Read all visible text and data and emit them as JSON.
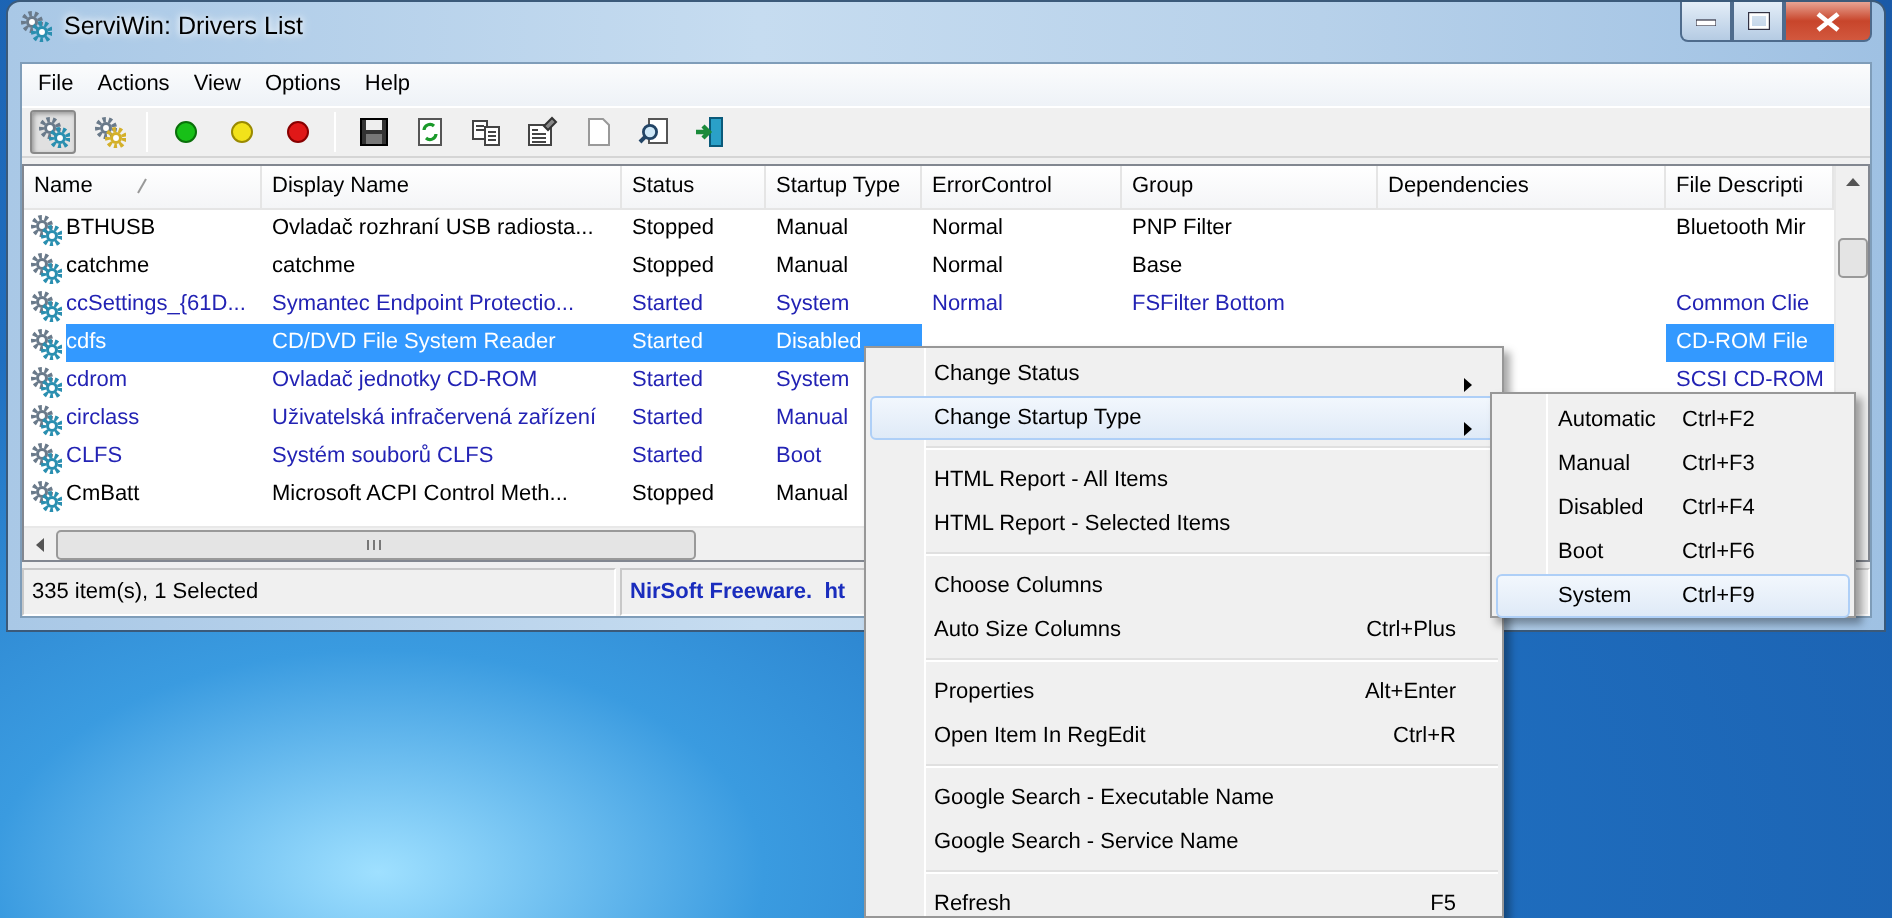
{
  "window": {
    "title": "ServiWin: Drivers List"
  },
  "menu_bar": [
    "File",
    "Actions",
    "View",
    "Options",
    "Help"
  ],
  "toolbar": [
    {
      "kind": "drivers",
      "pressed": true
    },
    {
      "kind": "services",
      "pressed": false
    },
    {
      "kind": "separator"
    },
    {
      "kind": "start",
      "pressed": false
    },
    {
      "kind": "pause",
      "pressed": false
    },
    {
      "kind": "stop",
      "pressed": false
    },
    {
      "kind": "separator"
    },
    {
      "kind": "save",
      "pressed": false
    },
    {
      "kind": "refresh",
      "pressed": false
    },
    {
      "kind": "copy",
      "pressed": false
    },
    {
      "kind": "properties",
      "pressed": false
    },
    {
      "kind": "report",
      "pressed": false
    },
    {
      "kind": "find",
      "pressed": false
    },
    {
      "kind": "exit",
      "pressed": false
    }
  ],
  "table": {
    "columns": [
      {
        "label": "Name",
        "sorted": true
      },
      {
        "label": "Display Name",
        "sorted": false
      },
      {
        "label": "Status",
        "sorted": false
      },
      {
        "label": "Startup Type",
        "sorted": false
      },
      {
        "label": "ErrorControl",
        "sorted": false
      },
      {
        "label": "Group",
        "sorted": false
      },
      {
        "label": "Dependencies",
        "sorted": false
      },
      {
        "label": "File Descripti",
        "sorted": false
      }
    ],
    "rows": [
      {
        "name": "BTHUSB",
        "display_name": "Ovladač rozhraní USB radiosta...",
        "status": "Stopped",
        "startup_type": "Manual",
        "error_control": "Normal",
        "group": "PNP Filter",
        "file_description": "Bluetooth Mir",
        "running": false,
        "selected": false
      },
      {
        "name": "catchme",
        "display_name": "catchme",
        "status": "Stopped",
        "startup_type": "Manual",
        "error_control": "Normal",
        "group": "Base",
        "running": false,
        "selected": false
      },
      {
        "name": "ccSettings_{61D...",
        "display_name": "Symantec Endpoint Protectio...",
        "status": "Started",
        "startup_type": "System",
        "error_control": "Normal",
        "group": "FSFilter Bottom",
        "file_description": "Common Clie",
        "running": true,
        "selected": false
      },
      {
        "name": "cdfs",
        "display_name": "CD/DVD File System Reader",
        "status": "Started",
        "startup_type": "Disabled",
        "file_description": "CD-ROM File",
        "selected": true
      },
      {
        "name": "cdrom",
        "display_name": "Ovladač jednotky CD-ROM",
        "status": "Started",
        "startup_type": "System",
        "file_description": "SCSI CD-ROM",
        "running": true,
        "selected": false
      },
      {
        "name": "circlass",
        "display_name": "Uživatelská infračervená zařízení",
        "status": "Started",
        "startup_type": "Manual",
        "running": true,
        "selected": false
      },
      {
        "name": "CLFS",
        "display_name": "Systém souborů CLFS",
        "status": "Started",
        "startup_type": "Boot",
        "running": true,
        "selected": false
      },
      {
        "name": "CmBatt",
        "display_name": "Microsoft ACPI Control Meth...",
        "status": "Stopped",
        "startup_type": "Manual",
        "running": false,
        "selected": false
      }
    ]
  },
  "status_bar": {
    "count": "335 item(s), 1 Selected",
    "credit": "NirSoft Freeware.  ht"
  },
  "context_menu": [
    {
      "kind": "item",
      "label": "Change Status",
      "submenu": true,
      "highlighted": false
    },
    {
      "kind": "item",
      "label": "Change Startup Type",
      "submenu": true,
      "highlighted": true
    },
    {
      "kind": "separator"
    },
    {
      "kind": "item",
      "label": "HTML Report - All Items",
      "submenu": false,
      "highlighted": false
    },
    {
      "kind": "item",
      "label": "HTML Report - Selected Items",
      "submenu": false,
      "highlighted": false
    },
    {
      "kind": "separator"
    },
    {
      "kind": "item",
      "label": "Choose Columns",
      "submenu": false,
      "highlighted": false
    },
    {
      "kind": "item",
      "label": "Auto Size Columns",
      "shortcut": "Ctrl+Plus",
      "submenu": false,
      "highlighted": false
    },
    {
      "kind": "separator"
    },
    {
      "kind": "item",
      "label": "Properties",
      "shortcut": "Alt+Enter",
      "submenu": false,
      "highlighted": false
    },
    {
      "kind": "item",
      "label": "Open Item In RegEdit",
      "shortcut": "Ctrl+R",
      "submenu": false,
      "highlighted": false
    },
    {
      "kind": "separator"
    },
    {
      "kind": "item",
      "label": "Google Search - Executable Name",
      "submenu": false,
      "highlighted": false
    },
    {
      "kind": "item",
      "label": "Google Search - Service Name",
      "submenu": false,
      "highlighted": false
    },
    {
      "kind": "separator"
    },
    {
      "kind": "item",
      "label": "Refresh",
      "shortcut": "F5",
      "submenu": false,
      "highlighted": false
    }
  ],
  "submenu": [
    {
      "label": "Automatic",
      "shortcut": "Ctrl+F2",
      "highlighted": false
    },
    {
      "label": "Manual",
      "shortcut": "Ctrl+F3",
      "highlighted": false
    },
    {
      "label": "Disabled",
      "shortcut": "Ctrl+F4",
      "highlighted": false
    },
    {
      "label": "Boot",
      "shortcut": "Ctrl+F6",
      "highlighted": false
    },
    {
      "label": "System",
      "shortcut": "Ctrl+F9",
      "highlighted": true
    }
  ]
}
